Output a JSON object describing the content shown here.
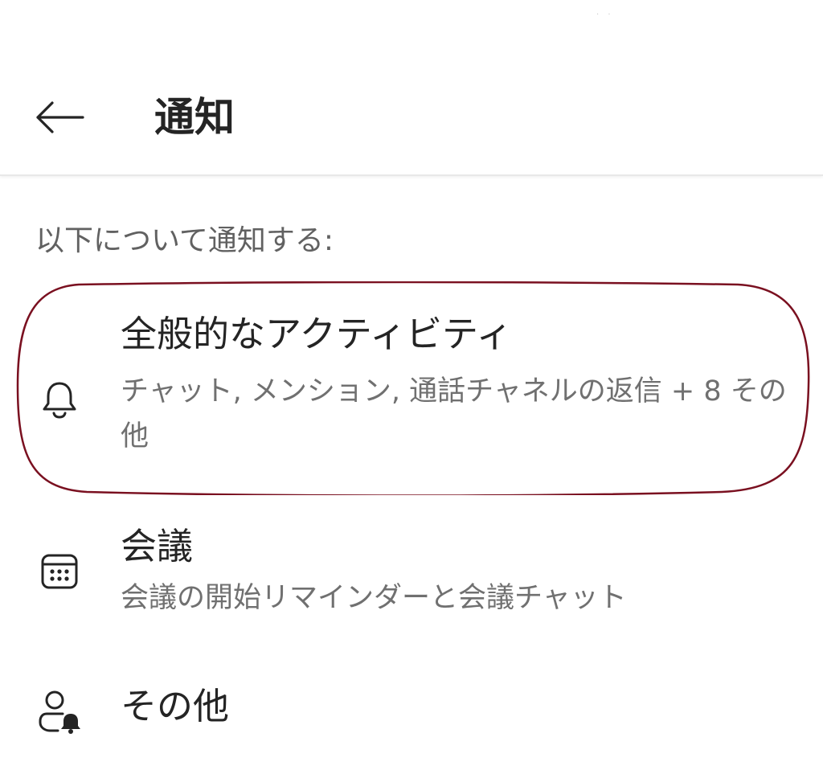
{
  "status_bar": {
    "indicator": "· ·"
  },
  "header": {
    "back_icon": "arrow-left-icon",
    "title": "通知"
  },
  "section": {
    "label": "以下について通知する:"
  },
  "items": [
    {
      "icon": "bell-icon",
      "title": "全般的なアクティビティ",
      "description": "チャット, メンション, 通話チャネルの返信 + 8 その他"
    },
    {
      "icon": "calendar-icon",
      "title": "会議",
      "description": "会議の開始リマインダーと会議チャット"
    },
    {
      "icon": "person-bell-icon",
      "title": "その他",
      "description": ""
    }
  ],
  "colors": {
    "highlight_ring": "#7a1020",
    "title_text": "#242424",
    "secondary_text": "#707070",
    "section_text": "#616161"
  }
}
